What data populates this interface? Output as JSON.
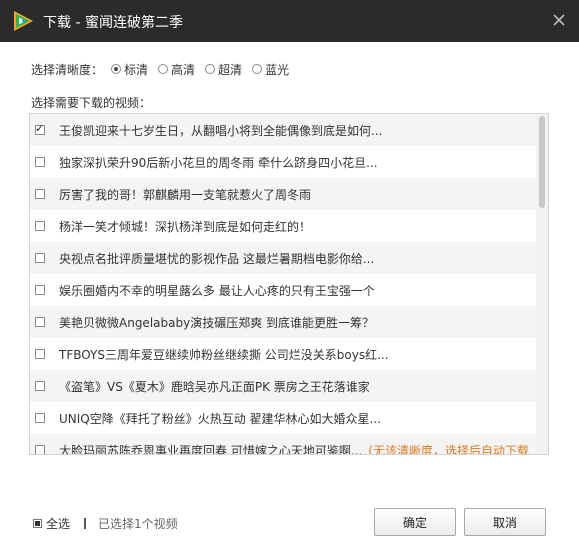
{
  "window": {
    "title": "下载 - 蜜闻连破第二季"
  },
  "clarity": {
    "label": "选择清晰度：",
    "options": [
      {
        "label": "标清",
        "selected": true
      },
      {
        "label": "高清",
        "selected": false
      },
      {
        "label": "超清",
        "selected": false
      },
      {
        "label": "蓝光",
        "selected": false
      }
    ]
  },
  "videos": {
    "section_label": "选择需要下载的视频：",
    "items": [
      {
        "title": "王俊凯迎来十七岁生日，从翻唱小将到全能偶像到底是如何...",
        "checked": true,
        "note": ""
      },
      {
        "title": "独家深扒荣升90后新小花旦的周冬雨 牵什么跻身四小花旦...",
        "checked": false,
        "note": ""
      },
      {
        "title": "厉害了我的哥！郭麒麟用一支笔就惹火了周冬雨",
        "checked": false,
        "note": ""
      },
      {
        "title": "杨洋一笑才倾城！深扒杨洋到底是如何走红的！",
        "checked": false,
        "note": ""
      },
      {
        "title": "央视点名批评质量堪忧的影视作品 这最烂暑期档电影你给...",
        "checked": false,
        "note": ""
      },
      {
        "title": "娱乐圈婚内不幸的明星蕗么多 最让人心疼的只有王宝强一个",
        "checked": false,
        "note": ""
      },
      {
        "title": "美艳贝微微Angelababy演技碾压郑爽 到底谁能更胜一筹？",
        "checked": false,
        "note": ""
      },
      {
        "title": "TFBOYS三周年爱豆继续帅粉丝继续撕 公司烂没关系boys红...",
        "checked": false,
        "note": ""
      },
      {
        "title": "《盗笔》VS《夏木》鹿晗吴亦凡正面PK 票房之王花落谁家",
        "checked": false,
        "note": ""
      },
      {
        "title": "UNIQ空降《拜托了粉丝》火热互动 翟建华林心如大婚众星...",
        "checked": false,
        "note": ""
      },
      {
        "title": "大脸玛丽苏陈乔恩事业再度回春 可惜嫁之心天地可鉴啊...",
        "checked": false,
        "note": "(无该清晰度，选择后自动下载"
      }
    ]
  },
  "footer": {
    "select_all_label": "全选",
    "selected_count": "已选择1个视频",
    "confirm_label": "确定",
    "cancel_label": "取消"
  },
  "colors": {
    "titlebar": "#2b2b2b",
    "note": "#e07a1f",
    "logo_green": "#36b24a",
    "logo_blue": "#1f8fe6",
    "logo_orange": "#f5a623"
  },
  "icons": {
    "logo": "tencent-video-logo-icon",
    "close": "close-icon"
  }
}
